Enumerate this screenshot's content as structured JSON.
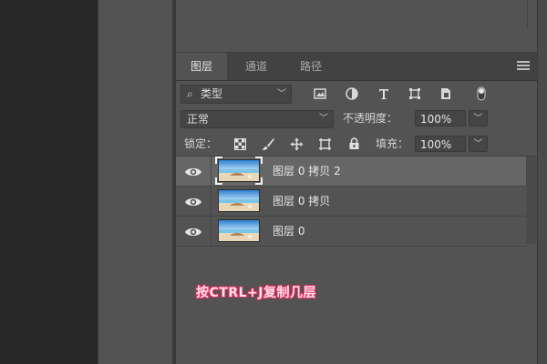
{
  "tabs": [
    {
      "label": "图层",
      "active": true
    },
    {
      "label": "通道",
      "active": false
    },
    {
      "label": "路径",
      "active": false
    }
  ],
  "filter": {
    "icon": "search-icon",
    "label": "类型",
    "icons": [
      "image-filter-icon",
      "adjustment-filter-icon",
      "type-filter-icon",
      "shape-filter-icon",
      "smart-object-filter-icon",
      "filter-toggle-icon"
    ]
  },
  "blend": {
    "mode": "正常",
    "opacity_label": "不透明度：",
    "opacity_value": "100%"
  },
  "lock": {
    "label": "锁定：",
    "icons": [
      "lock-transparent-icon",
      "lock-image-icon",
      "lock-position-icon",
      "lock-artboard-icon",
      "lock-all-icon"
    ],
    "fill_label": "填充：",
    "fill_value": "100%"
  },
  "layers": [
    {
      "name": "图层 0 拷贝 2",
      "selected": true,
      "visible": true
    },
    {
      "name": "图层 0 拷贝",
      "selected": false,
      "visible": true
    },
    {
      "name": "图层 0",
      "selected": false,
      "visible": true
    }
  ],
  "annotation": "按CTRL+J复制几层",
  "colors": {
    "panel": "#535353",
    "tabbar": "#424242",
    "selected_row": "#666666",
    "annotation_stroke": "#e03060"
  }
}
